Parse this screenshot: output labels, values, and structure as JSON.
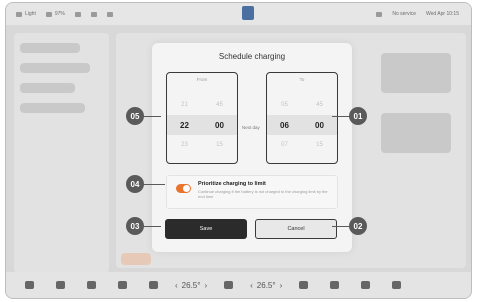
{
  "statusbar": {
    "left_items": [
      "Light",
      "97%"
    ],
    "right_items": [
      "No service",
      "Wed Apr 10:15"
    ]
  },
  "dialog": {
    "title": "Schedule charging",
    "from_picker": {
      "label": "From",
      "above": [
        "21",
        "45"
      ],
      "selected": [
        "22",
        "00"
      ],
      "below": [
        "23",
        "15"
      ]
    },
    "to_picker": {
      "label": "To",
      "above": [
        "05",
        "45"
      ],
      "selected": [
        "06",
        "00"
      ],
      "below": [
        "07",
        "15"
      ]
    },
    "next_day_label": "Next day",
    "option": {
      "title": "Prioritize charging to limit",
      "description": "Continue charging if the battery is not charged to the charging limit by the end time",
      "toggle_on": true,
      "toggle_color": "#e9742c"
    },
    "save_label": "Save",
    "cancel_label": "Cancel"
  },
  "callouts": [
    "05",
    "01",
    "04",
    "03",
    "02"
  ],
  "dock": {
    "left_temp": "26.5°",
    "right_temp": "26.5°",
    "icons": [
      "home-icon",
      "car-icon",
      "seat-icon",
      "media-icon",
      "phone-icon",
      "fan-icon",
      "wiper-icon",
      "music-icon",
      "apps-icon",
      "volume-icon"
    ]
  }
}
